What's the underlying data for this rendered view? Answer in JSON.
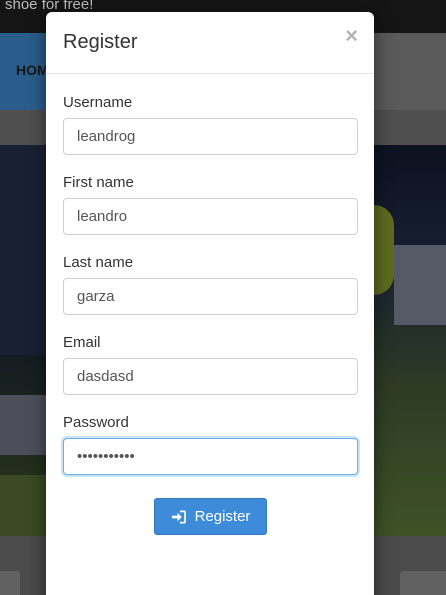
{
  "background": {
    "topbar_text": "shoe for free!",
    "nav_home": "HOME"
  },
  "modal": {
    "title": "Register",
    "close_label": "×",
    "fields": [
      {
        "label": "Username",
        "value": "leandrog"
      },
      {
        "label": "First name",
        "value": "leandro"
      },
      {
        "label": "Last name",
        "value": "garza"
      },
      {
        "label": "Email",
        "value": "dasdasd"
      },
      {
        "label": "Password",
        "value": "•••••••••••"
      }
    ],
    "submit_label": "Register",
    "submit_icon": "sign-in-icon"
  },
  "colors": {
    "primary_button": "#3d8bd9",
    "focus_border": "#66afe9"
  }
}
